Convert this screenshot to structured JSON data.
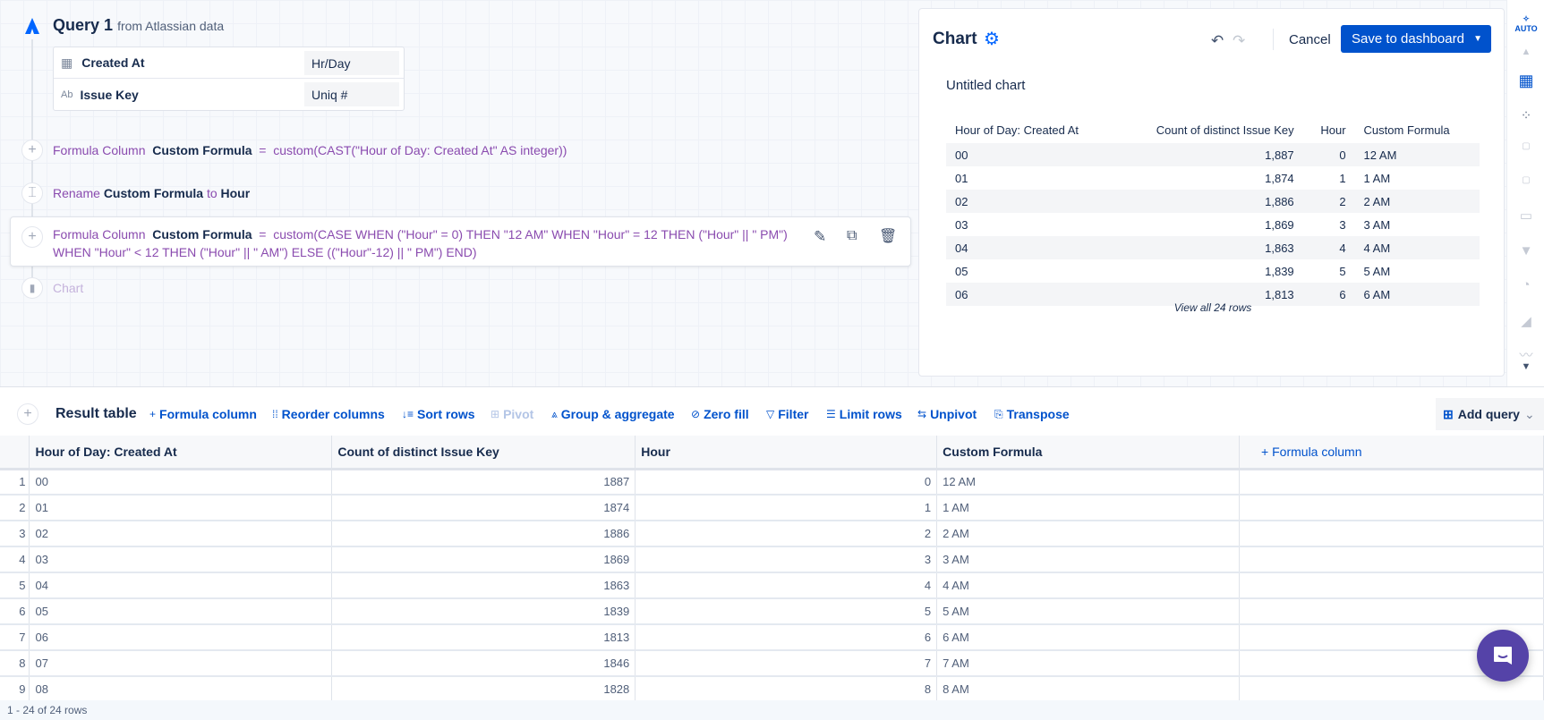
{
  "query": {
    "title": "Query 1",
    "source": "from Atlassian data",
    "fields": [
      {
        "icon": "calendar-icon",
        "name": "Created At",
        "agg": "Hr/Day"
      },
      {
        "icon": "text-type-icon",
        "icon_text": "Ab",
        "name": "Issue Key",
        "agg": "Uniq #"
      }
    ],
    "steps": [
      {
        "kind": "Formula Column",
        "name": "Custom Formula",
        "eq": "=",
        "expr": "custom(CAST(\"Hour of Day: Created At\" AS integer))"
      },
      {
        "kind": "Rename",
        "from": "Custom Formula",
        "to_word": "to",
        "to": "Hour"
      },
      {
        "kind": "Formula Column",
        "name": "Custom Formula",
        "eq": "=",
        "expr": "custom(CASE WHEN (\"Hour\" = 0) THEN \"12 AM\" WHEN \"Hour\" = 12 THEN (\"Hour\" || \" PM\")",
        "expr2": "WHEN \"Hour\" < 12 THEN (\"Hour\" || \" AM\") ELSE ((\"Hour\"-12) || \" PM\") END)"
      },
      {
        "kind": "Chart"
      }
    ]
  },
  "chart": {
    "title": "Chart",
    "cancel": "Cancel",
    "save": "Save to dashboard",
    "subtitle": "Untitled chart",
    "auto": "AUTO",
    "headers": [
      "Hour of Day: Created At",
      "Count of distinct Issue Key",
      "Hour",
      "Custom Formula"
    ],
    "rows": [
      [
        "00",
        "1,887",
        "0",
        "12 AM"
      ],
      [
        "01",
        "1,874",
        "1",
        "1 AM"
      ],
      [
        "02",
        "1,886",
        "2",
        "2 AM"
      ],
      [
        "03",
        "1,869",
        "3",
        "3 AM"
      ],
      [
        "04",
        "1,863",
        "4",
        "4 AM"
      ],
      [
        "05",
        "1,839",
        "5",
        "5 AM"
      ],
      [
        "06",
        "1,813",
        "6",
        "6 AM"
      ]
    ],
    "view_all": "View all 24 rows"
  },
  "result": {
    "title": "Result table",
    "toolbar": [
      "Formula column",
      "Reorder columns",
      "Sort rows",
      "Pivot",
      "Group & aggregate",
      "Zero fill",
      "Filter",
      "Limit rows",
      "Unpivot",
      "Transpose"
    ],
    "add_query": "Add query",
    "headers": [
      "Hour of Day: Created At",
      "Count of distinct Issue Key",
      "Hour",
      "Custom Formula"
    ],
    "add_formula": "Formula column",
    "rows": [
      [
        "1",
        "00",
        "1887",
        "0",
        "12 AM"
      ],
      [
        "2",
        "01",
        "1874",
        "1",
        "1 AM"
      ],
      [
        "3",
        "02",
        "1886",
        "2",
        "2 AM"
      ],
      [
        "4",
        "03",
        "1869",
        "3",
        "3 AM"
      ],
      [
        "5",
        "04",
        "1863",
        "4",
        "4 AM"
      ],
      [
        "6",
        "05",
        "1839",
        "5",
        "5 AM"
      ],
      [
        "7",
        "06",
        "1813",
        "6",
        "6 AM"
      ],
      [
        "8",
        "07",
        "1846",
        "7",
        "7 AM"
      ],
      [
        "9",
        "08",
        "1828",
        "8",
        "8 AM"
      ]
    ],
    "footer": "1 - 24 of 24 rows"
  },
  "colors": {
    "accent": "#0052cc",
    "formula": "#8a4baf",
    "chat": "#5543a8"
  }
}
